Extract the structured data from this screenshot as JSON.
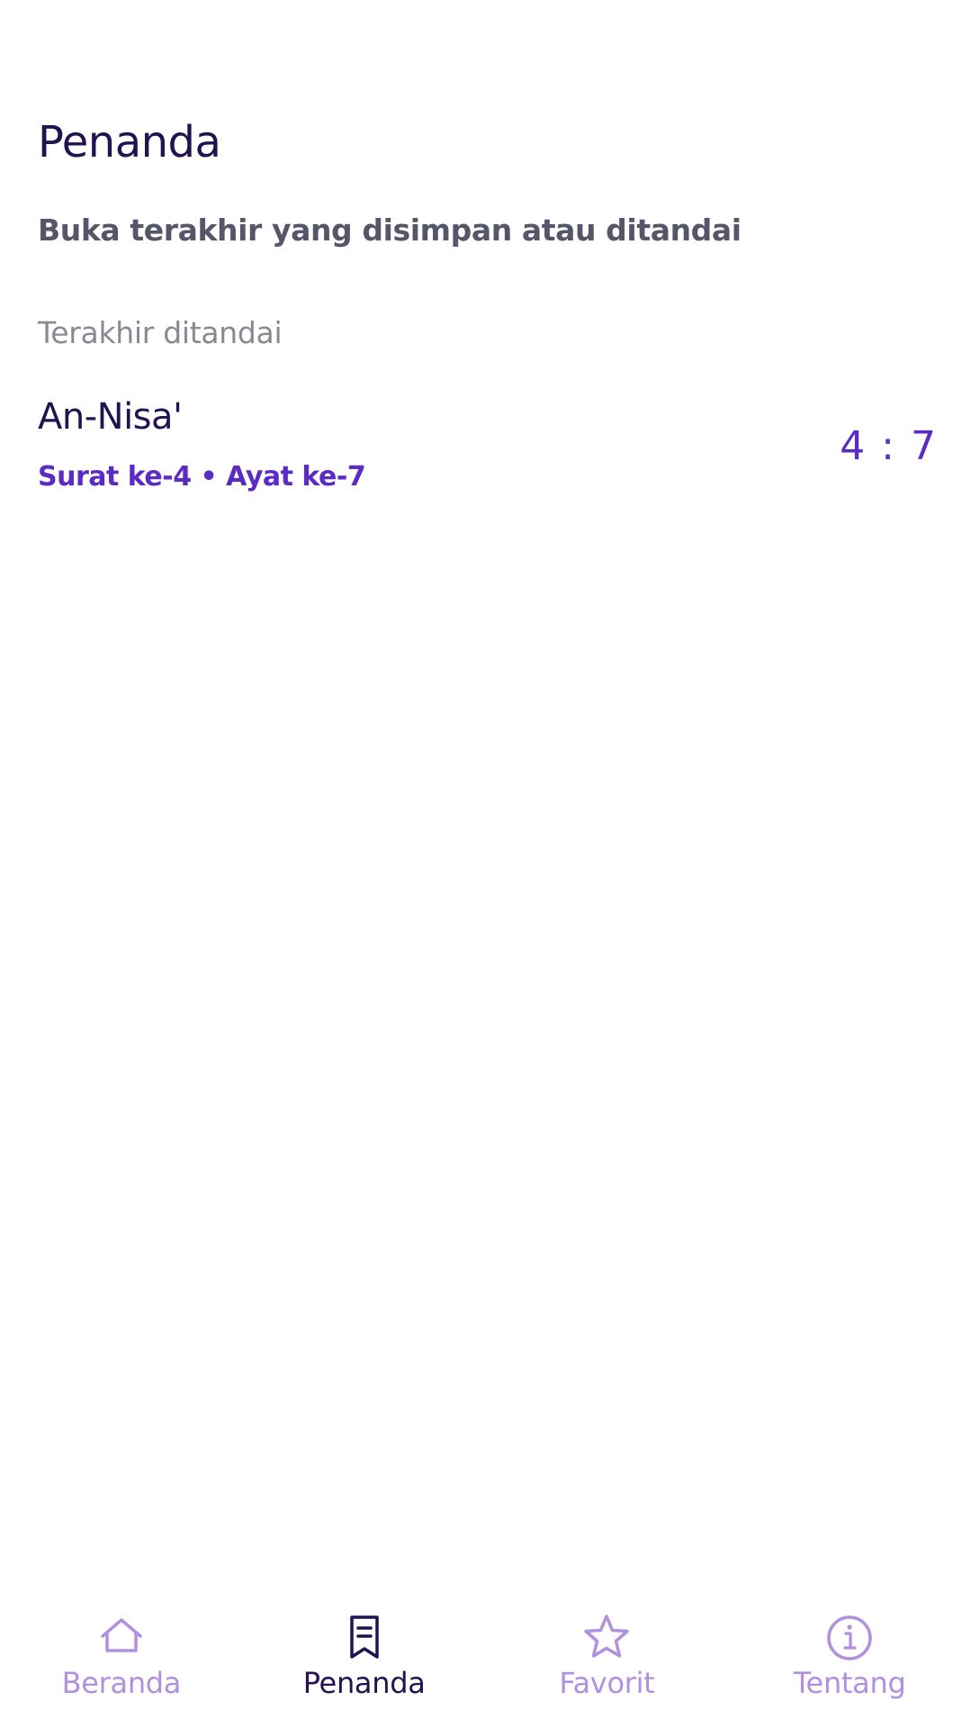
{
  "header": {
    "title": "Penanda",
    "subtitle": "Buka terakhir yang disimpan atau ditandai"
  },
  "section": {
    "label": "Terakhir ditandai"
  },
  "bookmarks": [
    {
      "surah_name": "An-Nisa'",
      "meta": "Surat ke-4 • Ayat ke-7",
      "reference": "4 : 7"
    }
  ],
  "bottom_nav": {
    "active": "Penanda",
    "items": [
      {
        "label": "Beranda",
        "icon": "home-icon"
      },
      {
        "label": "Penanda",
        "icon": "bookmark-icon"
      },
      {
        "label": "Favorit",
        "icon": "star-icon"
      },
      {
        "label": "Tentang",
        "icon": "info-icon"
      }
    ]
  },
  "colors": {
    "title": "#22124f",
    "subtitle": "#56566a",
    "muted": "#8a8893",
    "accent": "#5b2bc4",
    "nav_inactive": "#b090df",
    "nav_active": "#22124f"
  }
}
